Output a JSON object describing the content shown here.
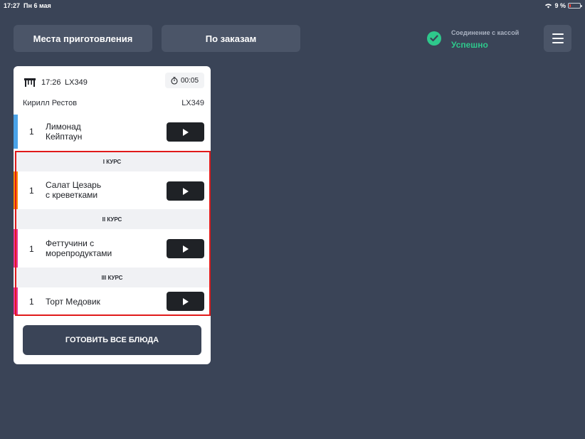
{
  "statusbar": {
    "time": "17:27",
    "date": "Пн 6 мая",
    "battery": "9 %"
  },
  "header": {
    "tab_places": "Места приготовления",
    "tab_orders": "По заказам",
    "connection_label": "Соединение с кассой",
    "connection_status": "Успешно"
  },
  "order": {
    "time": "17:26",
    "code": "LX349",
    "timer": "00:05",
    "waiter": "Кирилл Рестов",
    "code_right": "LX349",
    "items": [
      {
        "qty": "1",
        "line1": "Лимонад",
        "line2": "Кейптаун",
        "color": "#4aa3e8"
      },
      {
        "qty": "1",
        "line1": "Салат Цезарь",
        "line2": "с креветками",
        "color": "#ff8a00"
      },
      {
        "qty": "1",
        "line1": "Феттучини с",
        "line2": "морепродуктами",
        "color": "#e8359a"
      },
      {
        "qty": "1",
        "line1": "Торт Медовик",
        "line2": "",
        "color": "#e8359a"
      }
    ],
    "courses": [
      "I КУРС",
      "II КУРС",
      "III КУРС"
    ],
    "cook_all": "ГОТОВИТЬ ВСЕ БЛЮДА"
  }
}
